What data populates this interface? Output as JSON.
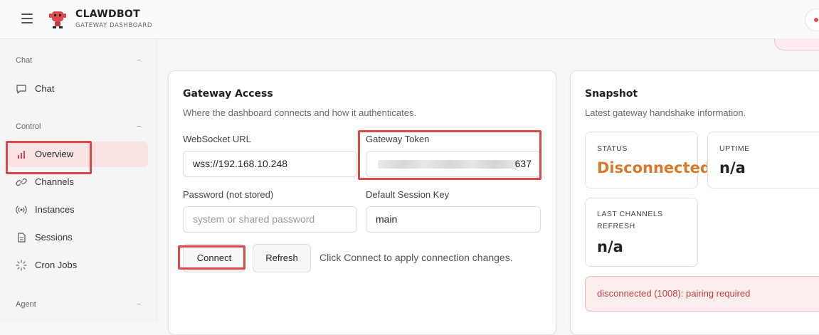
{
  "header": {
    "brand_title": "CLAWDBOT",
    "brand_subtitle": "GATEWAY DASHBOARD",
    "accent_color": "#e5484d"
  },
  "sidebar": {
    "sections": [
      {
        "label": "Chat",
        "toggle": "−",
        "items": [
          {
            "label": "Chat",
            "icon": "chat-bubble-icon"
          }
        ]
      },
      {
        "label": "Control",
        "toggle": "−",
        "items": [
          {
            "label": "Overview",
            "icon": "bar-chart-icon",
            "active": true
          },
          {
            "label": "Channels",
            "icon": "link-icon"
          },
          {
            "label": "Instances",
            "icon": "broadcast-icon"
          },
          {
            "label": "Sessions",
            "icon": "document-icon"
          },
          {
            "label": "Cron Jobs",
            "icon": "loader-icon"
          }
        ]
      },
      {
        "label": "Agent",
        "toggle": "−",
        "items": []
      }
    ]
  },
  "gateway_access": {
    "title": "Gateway Access",
    "subtitle": "Where the dashboard connects and how it authenticates.",
    "websocket_url_label": "WebSocket URL",
    "websocket_url_value": "wss://192.168.10.248",
    "gateway_token_label": "Gateway Token",
    "gateway_token_visible_tail": "637",
    "password_label": "Password (not stored)",
    "password_placeholder": "system or shared password",
    "session_key_label": "Default Session Key",
    "session_key_value": "main",
    "connect_label": "Connect",
    "refresh_label": "Refresh",
    "hint": "Click Connect to apply connection changes."
  },
  "snapshot": {
    "title": "Snapshot",
    "subtitle": "Latest gateway handshake information.",
    "status_label": "STATUS",
    "status_value": "Disconnected",
    "uptime_label": "UPTIME",
    "uptime_value": "n/a",
    "last_refresh_label": "LAST CHANNELS REFRESH",
    "last_refresh_value": "n/a",
    "alert": "disconnected (1008): pairing required"
  }
}
